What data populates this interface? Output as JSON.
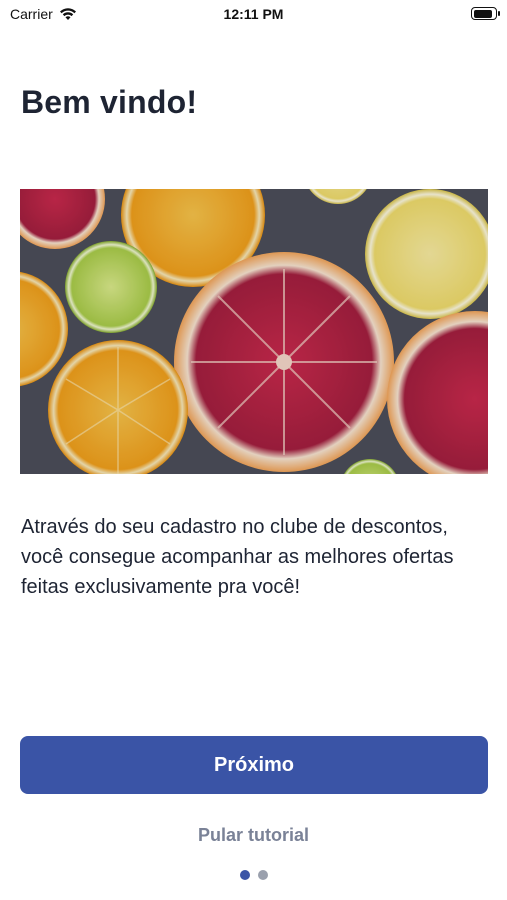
{
  "status_bar": {
    "carrier": "Carrier",
    "time": "12:11 PM",
    "battery_level": 0.9
  },
  "title": "Bem vindo!",
  "hero_image": {
    "subject": "sliced citrus fruits"
  },
  "description": "Através do seu cadastro no clube de descontos, você consegue acompanhar as melhores ofertas feitas exclusivamente pra você!",
  "buttons": {
    "next": "Próximo",
    "skip": "Pular tutorial"
  },
  "pagination": {
    "total": 2,
    "active_index": 0
  },
  "colors": {
    "primary": "#3a54a6",
    "title": "#1e2433",
    "muted": "#7a8297",
    "dot_inactive": "#9aa0ad"
  }
}
